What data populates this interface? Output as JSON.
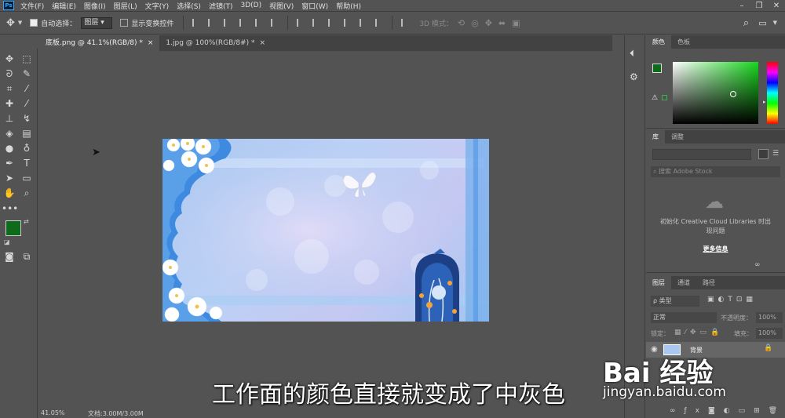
{
  "menubar": {
    "logo": "Ps",
    "items": [
      "文件(F)",
      "编辑(E)",
      "图像(I)",
      "图层(L)",
      "文字(Y)",
      "选择(S)",
      "滤镜(T)",
      "3D(D)",
      "视图(V)",
      "窗口(W)",
      "帮助(H)"
    ]
  },
  "options": {
    "auto_select_label": "自动选择：",
    "auto_select_value": "图层",
    "show_transform_label": "显示变换控件",
    "mode_3d_label": "3D 模式："
  },
  "tabs": [
    {
      "label": "底板.png @ 41.1%(RGB/8) *",
      "close": "×"
    },
    {
      "label": "1.jpg @ 100%(RGB/8#) *",
      "close": "×"
    }
  ],
  "status": {
    "zoom": "41.05%",
    "doc": "文档:3.00M/3.00M"
  },
  "color_panel": {
    "tabs": [
      "颜色",
      "色板"
    ],
    "foreground": "#0f6b1c",
    "background": "#ffffff"
  },
  "library_panel": {
    "tabs": [
      "库",
      "调整"
    ],
    "search_placeholder": "搜索 Adobe Stock",
    "message_line1": "初始化 Creative Cloud Libraries 时出",
    "message_line2": "现问题",
    "more_info": "更多信息"
  },
  "layers_panel": {
    "tabs": [
      "图层",
      "通道",
      "路径"
    ],
    "filter_label": "ρ 类型",
    "blend_mode": "正常",
    "opacity_label": "不透明度：",
    "opacity_value": "100%",
    "lock_label": "锁定：",
    "fill_label": "填充：",
    "fill_value": "100%",
    "layer_name": "背景"
  },
  "overlay": {
    "subtitle": "工作面的颜色直接就变成了中灰色",
    "watermark_brand": "Bai 经验",
    "watermark_url": "jingyan.baidu.com"
  }
}
